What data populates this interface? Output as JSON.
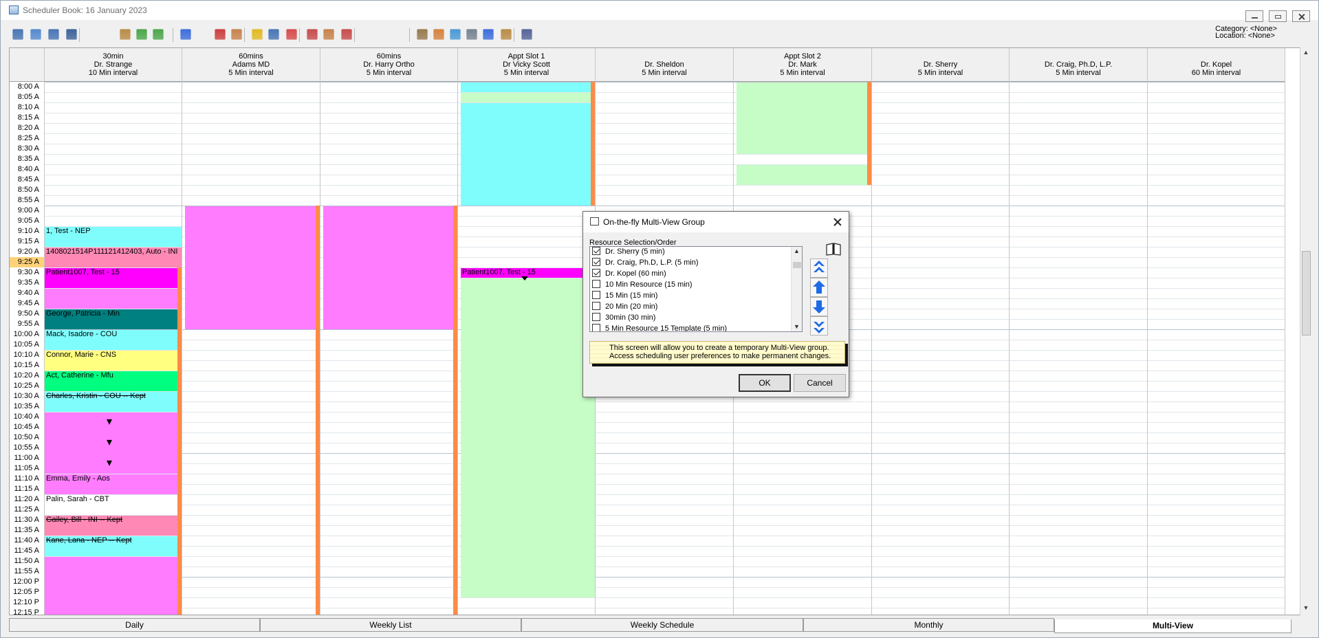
{
  "window": {
    "title": "Scheduler Book: 16 January 2023"
  },
  "header_info": {
    "category": "Category: <None>",
    "location": "Location: <None>"
  },
  "toolbar": {
    "icons": [
      "day-view-icon",
      "week-view-icon",
      "multi-view-icon",
      "month-view-icon",
      "resource-icon",
      "print-icon",
      "patient-icon",
      "group-icon",
      "checkin-icon",
      "add-icon",
      "edit-icon",
      "delete-icon",
      "refresh-icon",
      "flash-icon",
      "redo-icon",
      "person-icon",
      "move-icon",
      "copy-icon",
      "user-icon",
      "tools-icon",
      "pen-icon",
      "timer-icon",
      "phone-icon",
      "document-icon",
      "globe-icon",
      "calendar-icon",
      "plus-icon",
      "settings-icon",
      "exit-icon"
    ]
  },
  "columns": [
    {
      "line1": "30min",
      "line2": "Dr. Strange",
      "line3": "10 Min interval"
    },
    {
      "line1": "60mins",
      "line2": "Adams MD",
      "line3": "5 Min interval"
    },
    {
      "line1": "60mins",
      "line2": "Dr. Harry Ortho",
      "line3": "5 Min interval"
    },
    {
      "line1": "Appt Slot 1",
      "line2": "Dr Vicky Scott",
      "line3": "5 Min interval"
    },
    {
      "line1": "",
      "line2": "Dr. Sheldon",
      "line3": "5 Min interval"
    },
    {
      "line1": "Appt Slot 2",
      "line2": "Dr. Mark",
      "line3": "5 Min interval"
    },
    {
      "line1": "",
      "line2": "Dr. Sherry",
      "line3": "5 Min interval"
    },
    {
      "line1": "",
      "line2": "Dr. Craig, Ph.D, L.P.",
      "line3": "5 Min interval"
    },
    {
      "line1": "",
      "line2": "Dr. Kopel",
      "line3": "60 Min interval"
    }
  ],
  "times": [
    "8:00 A",
    "8:05 A",
    "8:10 A",
    "8:15 A",
    "8:20 A",
    "8:25 A",
    "8:30 A",
    "8:35 A",
    "8:40 A",
    "8:45 A",
    "8:50 A",
    "8:55 A",
    "9:00 A",
    "9:05 A",
    "9:10 A",
    "9:15 A",
    "9:20 A",
    "9:25 A",
    "9:30 A",
    "9:35 A",
    "9:40 A",
    "9:45 A",
    "9:50 A",
    "9:55 A",
    "10:00 A",
    "10:05 A",
    "10:10 A",
    "10:15 A",
    "10:20 A",
    "10:25 A",
    "10:30 A",
    "10:35 A",
    "10:40 A",
    "10:45 A",
    "10:50 A",
    "10:55 A",
    "11:00 A",
    "11:05 A",
    "11:10 A",
    "11:15 A",
    "11:20 A",
    "11:25 A",
    "11:30 A",
    "11:35 A",
    "11:40 A",
    "11:45 A",
    "11:50 A",
    "11:55 A",
    "12:00 P",
    "12:05 P",
    "12:10 P",
    "12:15 P"
  ],
  "appointments": {
    "a1": "1, Test - NEP",
    "a2": "1408021514P111121412403, Auto - INI",
    "a3": "Patient1007, Test - 15",
    "a4": "George, Patricia - Min",
    "a5": "Mack, Isadore - COU",
    "a6": "Connor, Marie - CNS",
    "a7": "Act, Catherine - Mfu",
    "a8": "Charles, Kristin - COU -- Kept",
    "a9": "Emma, Emily - Aos",
    "a10": "Palin, Sarah - CBT",
    "a11": "Gailey, Bill - INI -- Kept",
    "a12": "Kane, Lana - NEP -- Kept",
    "a13": "Patient1007, Test - 15"
  },
  "dialog": {
    "title": "On-the-fly Multi-View Group",
    "label": "Resource Selection/Order",
    "items": [
      {
        "label": "Dr. Sherry (5 min)",
        "checked": true
      },
      {
        "label": "Dr. Craig, Ph.D, L.P. (5 min)",
        "checked": true
      },
      {
        "label": "Dr. Kopel (60 min)",
        "checked": true
      },
      {
        "label": "10 Min Resource (15 min)",
        "checked": false
      },
      {
        "label": "15 Min (15 min)",
        "checked": false
      },
      {
        "label": "20 Min (20 min)",
        "checked": false
      },
      {
        "label": "30min (30 min)",
        "checked": false
      },
      {
        "label": "5 Min Resource 15 Template (5 min)",
        "checked": false
      }
    ],
    "info_line1": "This screen will allow you to create a temporary Multi-View group.",
    "info_line2": "Access scheduling user preferences to make permanent changes.",
    "ok": "OK",
    "cancel": "Cancel"
  },
  "tabs": [
    "Daily",
    "Weekly List",
    "Weekly Schedule",
    "Monthly",
    "Multi-View"
  ],
  "colors": {
    "cyan": "#7ffdfd",
    "magenta": "#ff7cff",
    "green": "#c6fcc6",
    "orange": "#ff8b47",
    "pink": "#ff88b4",
    "teal": "#008080",
    "yellow": "#ffff80",
    "hot-magenta": "#ff00ff",
    "bright-green": "#00ff80"
  }
}
